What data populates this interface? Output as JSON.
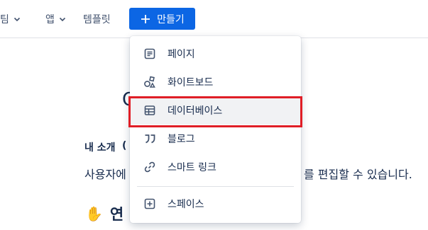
{
  "nav": {
    "teams": "팀",
    "apps": "앱",
    "templates": "템플릿",
    "create_label": "만들기"
  },
  "background": {
    "heading_partial": "O",
    "about_label": "내 소개",
    "about_paren": "(",
    "line_left": "사용자에",
    "line_right": "를 편집할 수 있습니다.",
    "contact_partial": "연"
  },
  "menu": {
    "items": [
      {
        "label": "페이지",
        "icon": "page-icon"
      },
      {
        "label": "화이트보드",
        "icon": "whiteboard-icon"
      },
      {
        "label": "데이터베이스",
        "icon": "database-icon"
      },
      {
        "label": "블로그",
        "icon": "blog-icon"
      },
      {
        "label": "스마트 링크",
        "icon": "link-icon"
      },
      {
        "label": "스페이스",
        "icon": "space-icon"
      }
    ],
    "selected_index": 2
  },
  "colors": {
    "accent": "#0c66e4",
    "highlight_border": "#e01e26",
    "hover_bg": "#f1f2f4",
    "text": "#172b4d"
  }
}
